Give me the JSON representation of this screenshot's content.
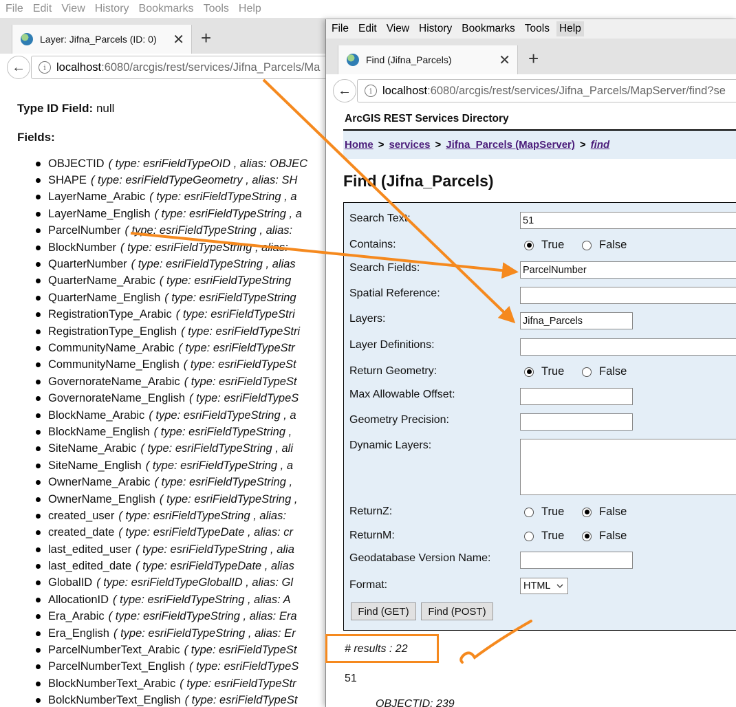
{
  "back_window": {
    "menu": [
      "File",
      "Edit",
      "View",
      "History",
      "Bookmarks",
      "Tools",
      "Help"
    ],
    "tab_title": "Layer: Jifna_Parcels (ID: 0)",
    "url_host": "localhost",
    "url_path": ":6080/arcgis/rest/services/Jifna_Parcels/Ma",
    "type_id_label": "Type ID Field:",
    "type_id_value": "null",
    "fields_heading": "Fields:",
    "fields": [
      {
        "name": "OBJECTID",
        "meta": "( type: esriFieldTypeOID , alias: OBJEC"
      },
      {
        "name": "SHAPE",
        "meta": "( type: esriFieldTypeGeometry , alias: SH"
      },
      {
        "name": "LayerName_Arabic",
        "meta": "( type: esriFieldTypeString , a"
      },
      {
        "name": "LayerName_English",
        "meta": "( type: esriFieldTypeString , a"
      },
      {
        "name": "ParcelNumber",
        "meta": "( type: esriFieldTypeString , alias:"
      },
      {
        "name": "BlockNumber",
        "meta": "( type: esriFieldTypeString , alias:"
      },
      {
        "name": "QuarterNumber",
        "meta": "( type: esriFieldTypeString , alias"
      },
      {
        "name": "QuarterName_Arabic",
        "meta": "( type: esriFieldTypeString"
      },
      {
        "name": "QuarterName_English",
        "meta": "( type: esriFieldTypeString"
      },
      {
        "name": "RegistrationType_Arabic",
        "meta": "( type: esriFieldTypeStri"
      },
      {
        "name": "RegistrationType_English",
        "meta": "( type: esriFieldTypeStri"
      },
      {
        "name": "CommunityName_Arabic",
        "meta": "( type: esriFieldTypeStr"
      },
      {
        "name": "CommunityName_English",
        "meta": "( type: esriFieldTypeSt"
      },
      {
        "name": "GovernorateName_Arabic",
        "meta": "( type: esriFieldTypeSt"
      },
      {
        "name": "GovernorateName_English",
        "meta": "( type: esriFieldTypeS"
      },
      {
        "name": "BlockName_Arabic",
        "meta": "( type: esriFieldTypeString , a"
      },
      {
        "name": "BlockName_English",
        "meta": "( type: esriFieldTypeString ,"
      },
      {
        "name": "SiteName_Arabic",
        "meta": "( type: esriFieldTypeString , ali"
      },
      {
        "name": "SiteName_English",
        "meta": "( type: esriFieldTypeString , a"
      },
      {
        "name": "OwnerName_Arabic",
        "meta": "( type: esriFieldTypeString ,"
      },
      {
        "name": "OwnerName_English",
        "meta": "( type: esriFieldTypeString ,"
      },
      {
        "name": "created_user",
        "meta": "( type: esriFieldTypeString , alias:"
      },
      {
        "name": "created_date",
        "meta": "( type: esriFieldTypeDate , alias: cr"
      },
      {
        "name": "last_edited_user",
        "meta": "( type: esriFieldTypeString , alia"
      },
      {
        "name": "last_edited_date",
        "meta": "( type: esriFieldTypeDate , alias"
      },
      {
        "name": "GlobalID",
        "meta": "( type: esriFieldTypeGlobalID , alias: Gl"
      },
      {
        "name": "AllocationID",
        "meta": "( type: esriFieldTypeString , alias: A"
      },
      {
        "name": "Era_Arabic",
        "meta": "( type: esriFieldTypeString , alias: Era"
      },
      {
        "name": "Era_English",
        "meta": "( type: esriFieldTypeString , alias: Er"
      },
      {
        "name": "ParcelNumberText_Arabic",
        "meta": "( type: esriFieldTypeSt"
      },
      {
        "name": "ParcelNumberText_English",
        "meta": "( type: esriFieldTypeS"
      },
      {
        "name": "BlockNumberText_Arabic",
        "meta": "( type: esriFieldTypeStr"
      },
      {
        "name": "BolckNumberText_English",
        "meta": "( type: esriFieldTypeSt"
      }
    ]
  },
  "front_window": {
    "menu": [
      "File",
      "Edit",
      "View",
      "History",
      "Bookmarks",
      "Tools",
      "Help"
    ],
    "tab_title": "Find (Jifna_Parcels)",
    "url_host": "localhost",
    "url_path": ":6080/arcgis/rest/services/Jifna_Parcels/MapServer/find?se",
    "directory_title": "ArcGIS REST Services Directory",
    "breadcrumb": {
      "home": "Home",
      "services": "services",
      "service": "Jifna_Parcels (MapServer)",
      "current": "find",
      "sep": ">"
    },
    "page_title": "Find (Jifna_Parcels)",
    "form": {
      "search_text_label": "Search Text:",
      "search_text_value": "51",
      "contains_label": "Contains:",
      "search_fields_label": "Search Fields:",
      "search_fields_value": "ParcelNumber",
      "spatial_reference_label": "Spatial Reference:",
      "spatial_reference_value": "",
      "layers_label": "Layers:",
      "layers_value": "Jifna_Parcels",
      "layer_definitions_label": "Layer Definitions:",
      "layer_definitions_value": "",
      "return_geometry_label": "Return Geometry:",
      "max_offset_label": "Max Allowable Offset:",
      "max_offset_value": "",
      "geometry_precision_label": "Geometry Precision:",
      "geometry_precision_value": "",
      "dynamic_layers_label": "Dynamic Layers:",
      "dynamic_layers_value": "",
      "returnz_label": "ReturnZ:",
      "returnm_label": "ReturnM:",
      "gdb_version_label": "Geodatabase Version Name:",
      "gdb_version_value": "",
      "format_label": "Format:",
      "format_value": "HTML",
      "true_label": "True",
      "false_label": "False",
      "selected": {
        "contains": "True",
        "return_geometry": "True",
        "returnz": "False",
        "returnm": "False"
      },
      "find_get_label": "Find (GET)",
      "find_post_label": "Find (POST)"
    },
    "results_text": "# results : 22",
    "result_value": "51",
    "result_objectid": "OBJECTID: 239"
  },
  "annotation_color": "#f5891e"
}
